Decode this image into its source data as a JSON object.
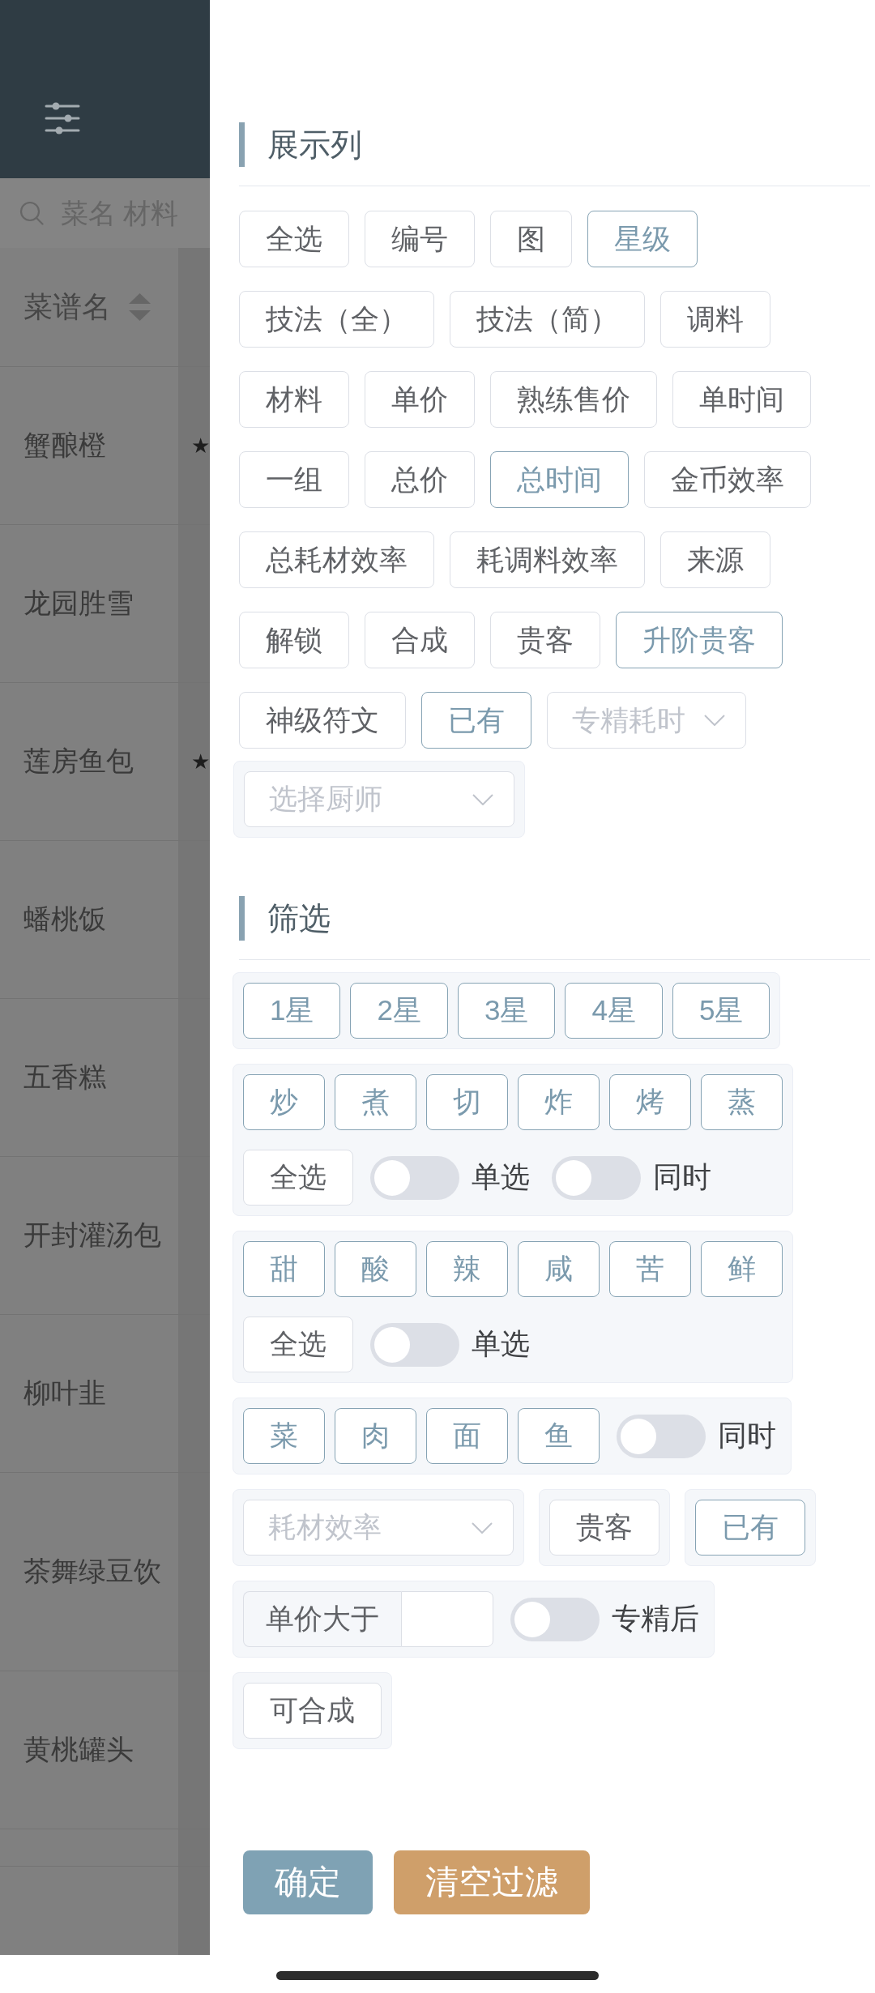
{
  "search": {
    "placeholder": "菜名 材料"
  },
  "table": {
    "columns": [
      {
        "label": "菜谱名",
        "sortable": true
      }
    ],
    "rows": [
      {
        "name": "蟹酿橙",
        "column_2": "★"
      },
      {
        "name": "龙园胜雪"
      },
      {
        "name": "莲房鱼包",
        "column_2": "★"
      },
      {
        "name": "蟠桃饭"
      },
      {
        "name": "五香糕"
      },
      {
        "name": "开封灌汤包"
      },
      {
        "name": "柳叶韭"
      },
      {
        "name": "茶舞绿豆饮"
      },
      {
        "name": "黄桃罐头"
      }
    ]
  },
  "drawer": {
    "display": {
      "title": "展示列",
      "items": [
        {
          "kind": "toggle",
          "label": "全选",
          "selected": false
        },
        {
          "kind": "toggle",
          "label": "编号",
          "selected": false
        },
        {
          "kind": "toggle",
          "label": "图",
          "selected": false
        },
        {
          "kind": "toggle",
          "label": "星级",
          "selected": true
        },
        {
          "kind": "toggle",
          "label": "技法（全）",
          "selected": false
        },
        {
          "kind": "toggle",
          "label": "技法（简）",
          "selected": false
        },
        {
          "kind": "toggle",
          "label": "调料",
          "selected": false
        },
        {
          "kind": "toggle",
          "label": "材料",
          "selected": false
        },
        {
          "kind": "toggle",
          "label": "单价",
          "selected": false
        },
        {
          "kind": "toggle",
          "label": "熟练售价",
          "selected": false
        },
        {
          "kind": "toggle",
          "label": "单时间",
          "selected": false
        },
        {
          "kind": "toggle",
          "label": "一组",
          "selected": false
        },
        {
          "kind": "toggle",
          "label": "总价",
          "selected": false
        },
        {
          "kind": "toggle",
          "label": "总时间",
          "selected": true
        },
        {
          "kind": "toggle",
          "label": "金币效率",
          "selected": false
        },
        {
          "kind": "toggle",
          "label": "总耗材效率",
          "selected": false
        },
        {
          "kind": "toggle",
          "label": "耗调料效率",
          "selected": false
        },
        {
          "kind": "toggle",
          "label": "来源",
          "selected": false
        },
        {
          "kind": "toggle",
          "label": "解锁",
          "selected": false
        },
        {
          "kind": "toggle",
          "label": "合成",
          "selected": false
        },
        {
          "kind": "toggle",
          "label": "贵客",
          "selected": false
        },
        {
          "kind": "toggle",
          "label": "升阶贵客",
          "selected": true
        },
        {
          "kind": "toggle",
          "label": "神级符文",
          "selected": false
        },
        {
          "kind": "toggle",
          "label": "已有",
          "selected": true
        },
        {
          "kind": "select",
          "placeholder": "专精耗时"
        },
        {
          "kind": "select_group",
          "placeholder": "选择厨师"
        }
      ]
    },
    "filter": {
      "title": "筛选",
      "groups": [
        {
          "rows": [
            {
              "items": [
                {
                  "kind": "toggle",
                  "label": "1星",
                  "selected": true
                },
                {
                  "kind": "toggle",
                  "label": "2星",
                  "selected": true
                },
                {
                  "kind": "toggle",
                  "label": "3星",
                  "selected": true
                },
                {
                  "kind": "toggle",
                  "label": "4星",
                  "selected": true
                },
                {
                  "kind": "toggle",
                  "label": "5星",
                  "selected": true
                }
              ]
            }
          ]
        },
        {
          "rows": [
            {
              "items": [
                {
                  "kind": "toggle",
                  "label": "炒",
                  "selected": true
                },
                {
                  "kind": "toggle",
                  "label": "煮",
                  "selected": true
                },
                {
                  "kind": "toggle",
                  "label": "切",
                  "selected": true
                },
                {
                  "kind": "toggle",
                  "label": "炸",
                  "selected": true
                },
                {
                  "kind": "toggle",
                  "label": "烤",
                  "selected": true
                },
                {
                  "kind": "toggle",
                  "label": "蒸",
                  "selected": true
                }
              ]
            },
            {
              "items": [
                {
                  "kind": "toggle",
                  "label": "全选",
                  "selected": false
                },
                {
                  "kind": "switch",
                  "label": "单选",
                  "on": false
                },
                {
                  "kind": "switch",
                  "label": "同时",
                  "on": false
                }
              ]
            }
          ]
        },
        {
          "rows": [
            {
              "items": [
                {
                  "kind": "toggle",
                  "label": "甜",
                  "selected": true
                },
                {
                  "kind": "toggle",
                  "label": "酸",
                  "selected": true
                },
                {
                  "kind": "toggle",
                  "label": "辣",
                  "selected": true
                },
                {
                  "kind": "toggle",
                  "label": "咸",
                  "selected": true
                },
                {
                  "kind": "toggle",
                  "label": "苦",
                  "selected": true
                },
                {
                  "kind": "toggle",
                  "label": "鲜",
                  "selected": true
                }
              ]
            },
            {
              "items": [
                {
                  "kind": "toggle",
                  "label": "全选",
                  "selected": false
                },
                {
                  "kind": "switch",
                  "label": "单选",
                  "on": false
                }
              ]
            }
          ]
        },
        {
          "rows": [
            {
              "items": [
                {
                  "kind": "toggle",
                  "label": "菜",
                  "selected": true
                },
                {
                  "kind": "toggle",
                  "label": "肉",
                  "selected": true
                },
                {
                  "kind": "toggle",
                  "label": "面",
                  "selected": true
                },
                {
                  "kind": "toggle",
                  "label": "鱼",
                  "selected": true
                },
                {
                  "kind": "switch",
                  "label": "同时",
                  "on": false
                }
              ]
            }
          ]
        },
        {
          "rows": [
            {
              "items": [
                {
                  "kind": "select",
                  "placeholder": "耗材效率"
                }
              ]
            }
          ]
        },
        {
          "rows": [
            {
              "items": [
                {
                  "kind": "toggle",
                  "label": "贵客",
                  "selected": false
                }
              ]
            }
          ]
        },
        {
          "rows": [
            {
              "items": [
                {
                  "kind": "toggle",
                  "label": "已有",
                  "selected": true
                }
              ]
            }
          ]
        },
        {
          "rows": [
            {
              "items": [
                {
                  "kind": "input",
                  "label": "单价大于"
                },
                {
                  "kind": "switch",
                  "label": "专精后",
                  "on": false
                }
              ]
            }
          ]
        },
        {
          "rows": [
            {
              "items": [
                {
                  "kind": "toggle",
                  "label": "可合成",
                  "selected": false
                }
              ]
            }
          ]
        }
      ]
    },
    "actions": [
      {
        "kind": "confirm",
        "label": "确定"
      },
      {
        "kind": "clear",
        "label": "清空过滤"
      }
    ]
  }
}
